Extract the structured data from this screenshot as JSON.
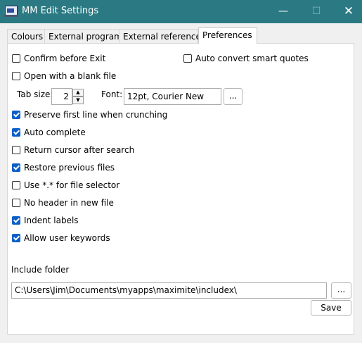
{
  "window": {
    "title": "MM Edit Settings",
    "controls": {
      "minimize": "—",
      "maximize": "☐",
      "close": "✕"
    }
  },
  "tabs": [
    "Colours",
    "External programs",
    "External references",
    "Preferences"
  ],
  "active_tab": "Preferences",
  "preferences": {
    "confirm_exit": {
      "label": "Confirm before Exit",
      "checked": false
    },
    "auto_convert": {
      "label": "Auto convert smart quotes",
      "checked": false
    },
    "open_blank": {
      "label": "Open with a blank file",
      "checked": false
    },
    "tab_size_label": "Tab size:",
    "tab_size": "2",
    "font_label": "Font:",
    "font_value": "12pt,  Courier New",
    "font_button": "...",
    "checkboxes": [
      {
        "label": "Preserve first line when crunching",
        "checked": true
      },
      {
        "label": "Auto complete",
        "checked": true
      },
      {
        "label": "Return cursor after search",
        "checked": false
      },
      {
        "label": "Restore previous files",
        "checked": true
      },
      {
        "label": "Use *.* for file selector",
        "checked": false
      },
      {
        "label": "No header in new file",
        "checked": false
      },
      {
        "label": "Indent labels",
        "checked": true
      },
      {
        "label": "Allow user keywords",
        "checked": true
      }
    ],
    "include_folder_label": "Include folder",
    "include_folder_value": "C:\\Users\\Jim\\Documents\\myapps\\maximite\\includex\\",
    "browse_button": "...",
    "save_button": "Save"
  },
  "colors": {
    "titlebar": "#2b7a83",
    "checkbox_checked": "#0a5fc9"
  }
}
